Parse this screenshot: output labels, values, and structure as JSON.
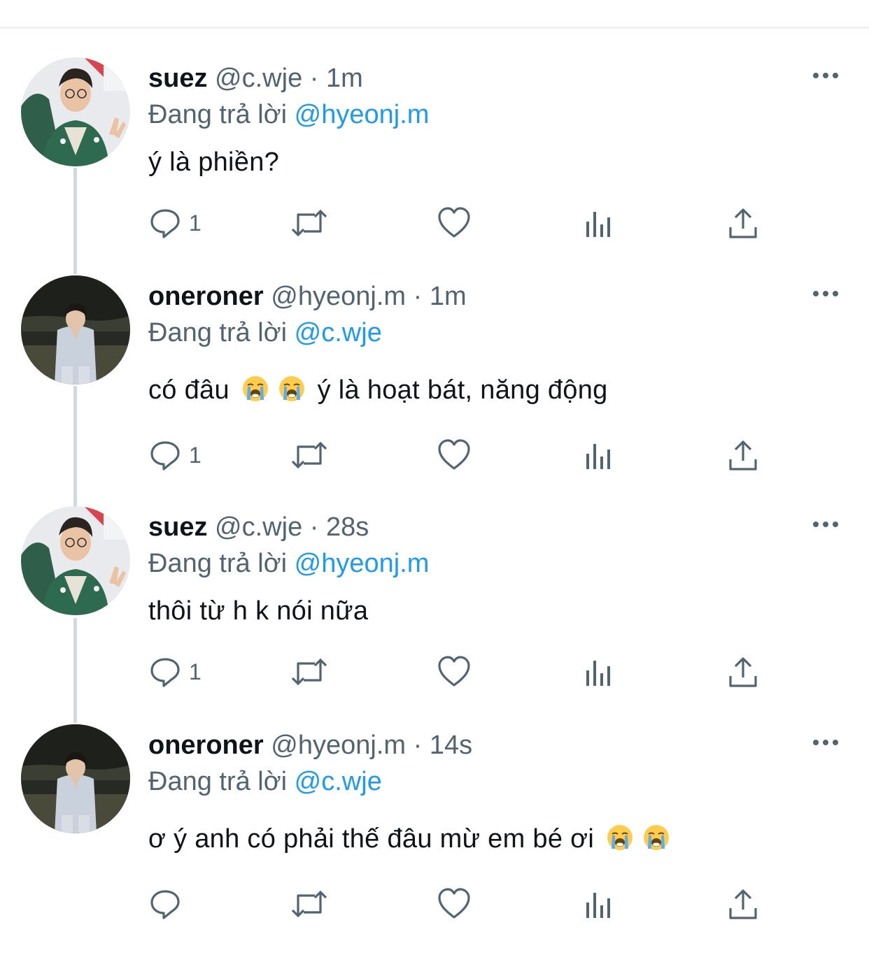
{
  "reply_prefix": "Đang trả lời",
  "tweets": [
    {
      "name": "suez",
      "handle": "@c.wje",
      "separator": "·",
      "time": "1m",
      "reply_to": "@hyeonj.m",
      "text": "ý là phiền?",
      "reply_count": "1",
      "avatar": "avatar-suez"
    },
    {
      "name": "oneroner",
      "handle": "@hyeonj.m",
      "separator": "·",
      "time": "1m",
      "reply_to": "@c.wje",
      "text_before": "có đâu",
      "text_after": "ý là hoạt bát, năng động",
      "emojis": [
        "loudly-crying-face",
        "loudly-crying-face"
      ],
      "reply_count": "1",
      "avatar": "avatar-oneroner"
    },
    {
      "name": "suez",
      "handle": "@c.wje",
      "separator": "·",
      "time": "28s",
      "reply_to": "@hyeonj.m",
      "text": "thôi từ h k nói nữa",
      "reply_count": "1",
      "avatar": "avatar-suez"
    },
    {
      "name": "oneroner",
      "handle": "@hyeonj.m",
      "separator": "·",
      "time": "14s",
      "reply_to": "@c.wje",
      "text": "ơ ý anh có phải thế đâu mừ em bé ơi",
      "emojis": [
        "loudly-crying-face",
        "loudly-crying-face"
      ],
      "reply_count": "",
      "avatar": "avatar-oneroner"
    }
  ],
  "icons": {
    "reply": "reply-icon",
    "retweet": "retweet-icon",
    "like": "like-icon",
    "views": "views-icon",
    "share": "share-icon",
    "more": "more-icon"
  },
  "colors": {
    "text": "#0f1419",
    "secondary": "#536471",
    "link": "#1d9bf0",
    "thread_line": "#cfd9de"
  }
}
